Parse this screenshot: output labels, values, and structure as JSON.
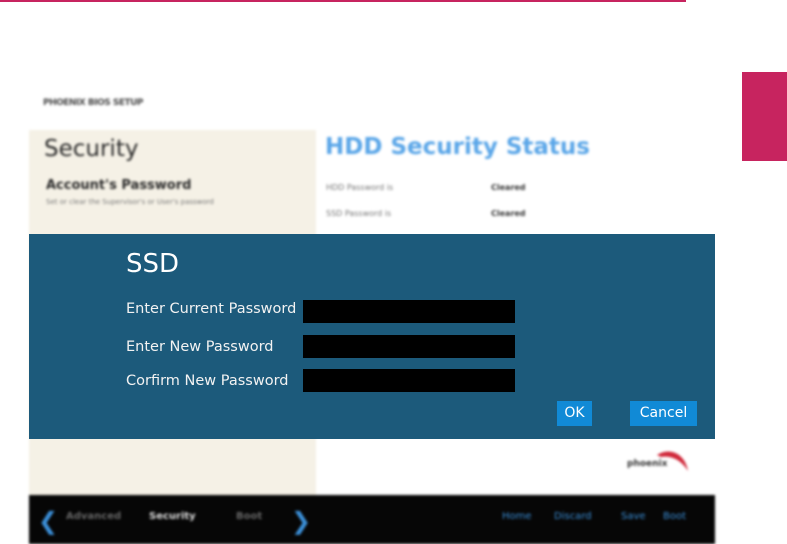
{
  "bios": {
    "brand_small": "PHOENIX BIOS SETUP",
    "section_title": "Security",
    "account_title": "Account's Password",
    "account_desc": "Set or clear the Supervisor's or User's password",
    "status_title": "HDD Security Status",
    "status_rows": [
      {
        "label": "HDD Password is",
        "value": "Cleared"
      },
      {
        "label": "SSD Password is",
        "value": "Cleared"
      }
    ],
    "logo_text": "phoenix",
    "bottom_nav": {
      "tabs": [
        "Advanced",
        "Security",
        "Boot"
      ],
      "actions": [
        "Home",
        "Discard",
        "Save",
        "Boot"
      ]
    }
  },
  "dialog": {
    "title": "SSD",
    "fields": [
      {
        "label": "Enter Current Password",
        "value": ""
      },
      {
        "label": "Enter New Password",
        "value": ""
      },
      {
        "label": "Corfirm New Password",
        "value": ""
      }
    ],
    "ok_label": "OK",
    "cancel_label": "Cancel"
  },
  "colors": {
    "accent_pink": "#c7245f",
    "dialog_bg": "#1c5a7b",
    "button_blue": "#118ad6",
    "bios_title_blue": "#5aa6e8"
  }
}
